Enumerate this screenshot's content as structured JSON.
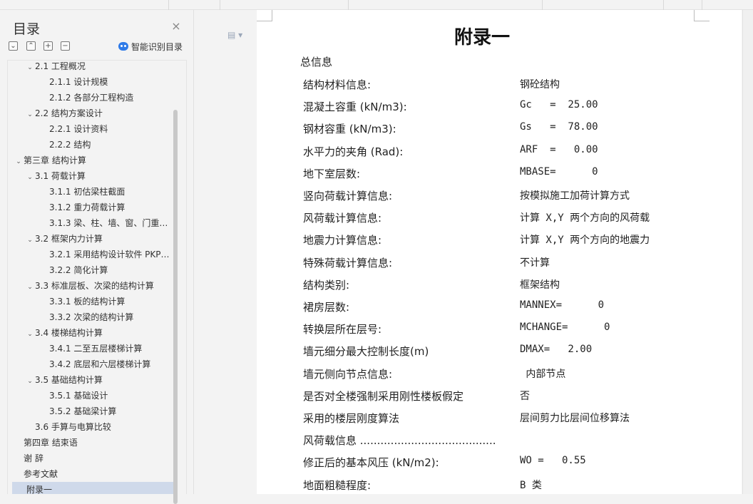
{
  "sidebar": {
    "title": "目录",
    "close_icon": "×",
    "tools": [
      "⌄",
      "⌃",
      "+",
      "−"
    ],
    "smart_label": "智能识别目录",
    "items": [
      {
        "label": "2.1  工程概况",
        "level": 1,
        "chev": "⌄"
      },
      {
        "label": "2.1.1 设计规模",
        "level": 2,
        "chev": ""
      },
      {
        "label": "2.1.2  各部分工程构造",
        "level": 2,
        "chev": ""
      },
      {
        "label": "2.2  结构方案设计",
        "level": 1,
        "chev": "⌄"
      },
      {
        "label": "2.2.1 设计资料",
        "level": 2,
        "chev": ""
      },
      {
        "label": "2.2.2  结构",
        "level": 2,
        "chev": ""
      },
      {
        "label": "第三章    结构计算",
        "level": 0,
        "chev": "⌄"
      },
      {
        "label": "3.1 荷载计算",
        "level": 1,
        "chev": "⌄"
      },
      {
        "label": "3.1.1  初估梁柱截面",
        "level": 2,
        "chev": ""
      },
      {
        "label": "3.1.2  重力荷载计算",
        "level": 2,
        "chev": ""
      },
      {
        "label": "3.1.3  梁、柱、墙、窗、门重…",
        "level": 2,
        "chev": ""
      },
      {
        "label": "3.2  框架内力计算",
        "level": 1,
        "chev": "⌄"
      },
      {
        "label": "3.2.1 采用结构设计软件 PKP…",
        "level": 2,
        "chev": ""
      },
      {
        "label": "3.2.2  简化计算",
        "level": 2,
        "chev": ""
      },
      {
        "label": "3.3 标准层板、次梁的结构计算",
        "level": 1,
        "chev": "⌄"
      },
      {
        "label": "3.3.1 板的结构计算",
        "level": 2,
        "chev": ""
      },
      {
        "label": "3.3.2 次梁的结构计算",
        "level": 2,
        "chev": ""
      },
      {
        "label": "3.4 楼梯结构计算",
        "level": 1,
        "chev": "⌄"
      },
      {
        "label": "3.4.1  二至五层楼梯计算",
        "level": 2,
        "chev": ""
      },
      {
        "label": "3.4.2  底层和六层楼梯计算",
        "level": 2,
        "chev": ""
      },
      {
        "label": "3.5 基础结构计算",
        "level": 1,
        "chev": "⌄"
      },
      {
        "label": "3.5.1   基础设计",
        "level": 2,
        "chev": ""
      },
      {
        "label": "3.5.2  基础梁计算",
        "level": 2,
        "chev": ""
      },
      {
        "label": "3.6  手算与电算比较",
        "level": 1,
        "chev": ""
      },
      {
        "label": "第四章  结束语",
        "level": 0,
        "chev": ""
      },
      {
        "label": "谢  辞",
        "level": 0,
        "chev": ""
      },
      {
        "label": "参考文献",
        "level": 0,
        "chev": ""
      },
      {
        "label": "附录一",
        "level": 0,
        "chev": "",
        "active": true
      }
    ]
  },
  "document": {
    "page_icon": "▤ ▾",
    "title": "附录一",
    "subtitle": "总信息",
    "rows": [
      {
        "label": "结构材料信息:",
        "value": "钢砼结构"
      },
      {
        "label": "混凝土容重 (kN/m3):",
        "value": "Gc   =  25.00"
      },
      {
        "label": "钢材容重 (kN/m3):",
        "value": "Gs   =  78.00"
      },
      {
        "label": "水平力的夹角 (Rad):",
        "value": "ARF  =   0.00"
      },
      {
        "label": "地下室层数:",
        "value": "MBASE=      0"
      },
      {
        "label": "竖向荷载计算信息:",
        "value": "按模拟施工加荷计算方式"
      },
      {
        "label": "风荷载计算信息:",
        "value": "计算 X,Y 两个方向的风荷载"
      },
      {
        "label": "地震力计算信息:",
        "value": "计算 X,Y 两个方向的地震力"
      },
      {
        "label": "特殊荷载计算信息:",
        "value": "不计算"
      },
      {
        "label": "结构类别:",
        "value": "框架结构"
      },
      {
        "label": "裙房层数:",
        "value": "MANNEX=      0"
      },
      {
        "label": "转换层所在层号:",
        "value": "MCHANGE=      0"
      },
      {
        "label": "墙元细分最大控制长度(m)",
        "value": "DMAX=   2.00"
      },
      {
        "label": "墙元侧向节点信息:",
        "value": " 内部节点"
      },
      {
        "label": "是否对全楼强制采用刚性楼板假定",
        "value": "否"
      },
      {
        "label": "采用的楼层刚度算法",
        "value": "层间剪力比层间位移算法"
      },
      {
        "label": "风荷载信息 ........................................",
        "value": ""
      },
      {
        "label": "修正后的基本风压 (kN/m2):",
        "value": "WO =   0.55"
      },
      {
        "label": "地面粗糙程度:",
        "value": "B 类"
      }
    ]
  }
}
